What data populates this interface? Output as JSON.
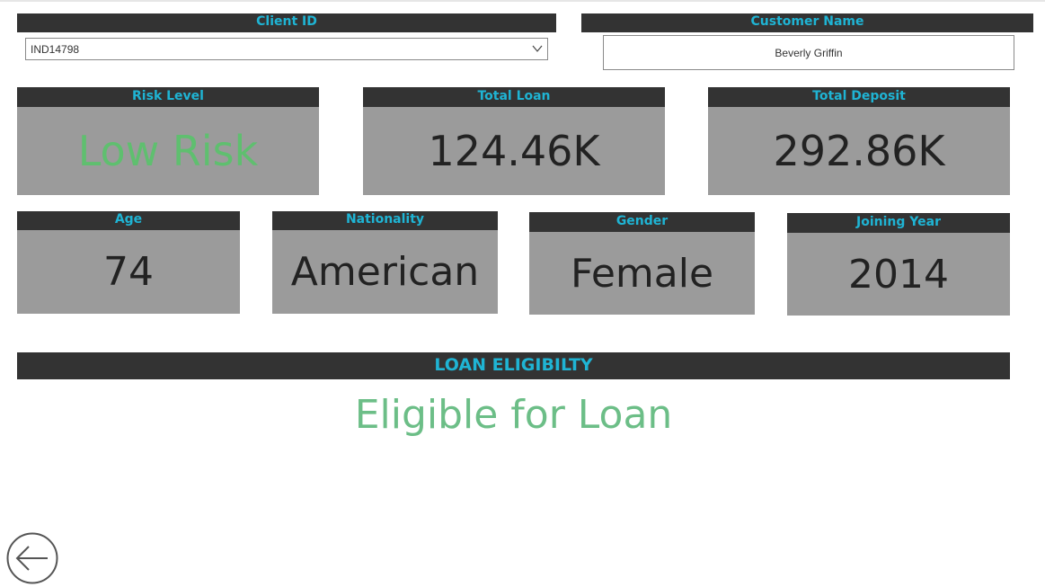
{
  "client_id": {
    "header": "Client ID",
    "selected_value": "IND14798"
  },
  "customer_name": {
    "header": "Customer Name",
    "value": "Beverly Griffin"
  },
  "risk_level": {
    "header": "Risk Level",
    "value": "Low Risk",
    "color": "#5fbf6f"
  },
  "total_loan": {
    "header": "Total Loan",
    "value": "124.46K"
  },
  "total_deposit": {
    "header": "Total Deposit",
    "value": "292.86K"
  },
  "age": {
    "header": "Age",
    "value": "74"
  },
  "nationality": {
    "header": "Nationality",
    "value": "American"
  },
  "gender": {
    "header": "Gender",
    "value": "Female"
  },
  "joining_year": {
    "header": "Joining Year",
    "value": "2014"
  },
  "loan_eligibility": {
    "header": "LOAN ELIGIBILTY",
    "value": "Eligible for Loan",
    "color": "#6cbe87"
  },
  "colors": {
    "header_bg": "#333333",
    "header_text": "#1fb4d4",
    "card_bg": "#9b9b9b",
    "card_text": "#222222"
  },
  "icons": {
    "dropdown": "chevron-down-icon",
    "back": "back-arrow-icon"
  }
}
